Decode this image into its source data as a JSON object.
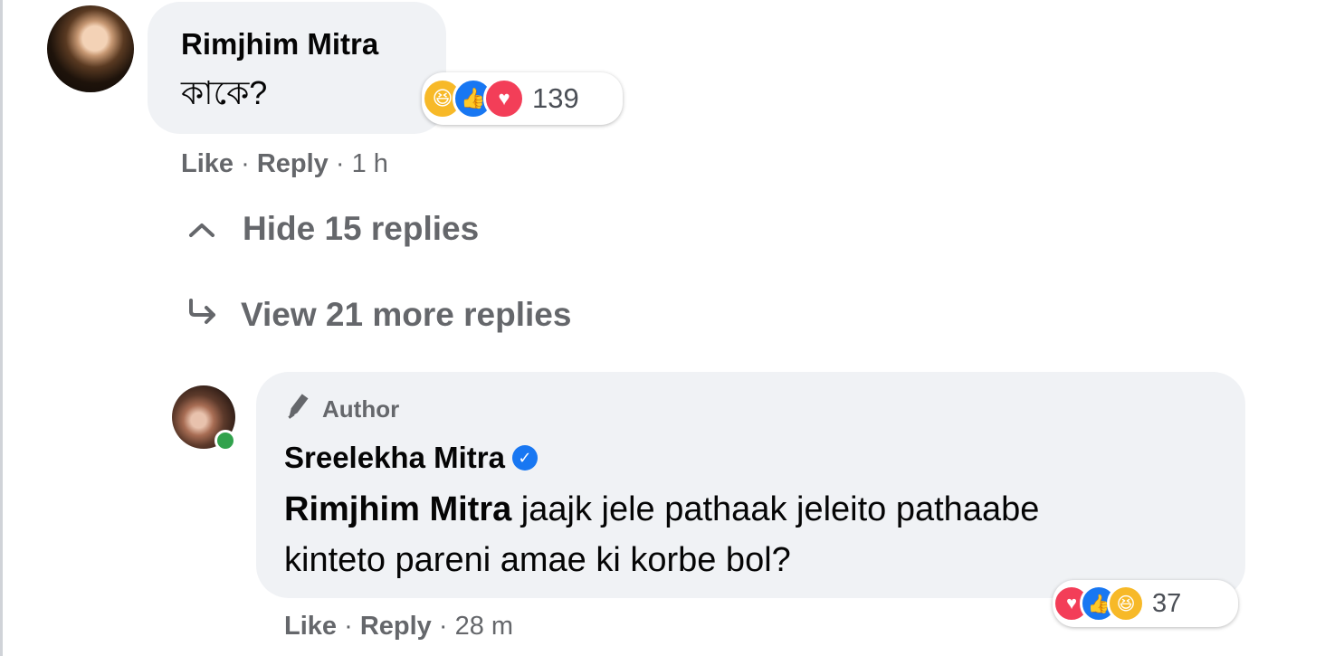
{
  "comment": {
    "author": "Rimjhim Mitra",
    "text": "কাকে?",
    "reactions": {
      "icons": [
        "haha-icon",
        "like-icon",
        "love-icon"
      ],
      "count": "139"
    },
    "actions": {
      "like": "Like",
      "sep1": " · ",
      "reply": "Reply",
      "sep2": " · ",
      "time": "1 h"
    }
  },
  "thread": {
    "hide_icon": "^",
    "hide_label": "Hide 15 replies",
    "more_icon": "↪",
    "more_label": "View 21 more replies"
  },
  "reply": {
    "badge": "Author",
    "author": "Sreelekha Mitra",
    "mention": "Rimjhim Mitra",
    "line1": " jaajk jele pathaak jeleito pathaabe",
    "line2": "kinteto pareni amae ki korbe bol?",
    "reactions": {
      "icons": [
        "love-icon",
        "like-icon",
        "haha-icon"
      ],
      "count": "37"
    },
    "actions": {
      "like": "Like",
      "sep1": " · ",
      "reply": "Reply",
      "sep2": " · ",
      "time": "28 m"
    }
  },
  "colors": {
    "bubble": "#f0f2f5",
    "meta_text": "#65676b",
    "like_blue": "#1877f2",
    "love_red": "#f33e58",
    "haha_yellow": "#f7b928",
    "online_green": "#31a24c"
  }
}
